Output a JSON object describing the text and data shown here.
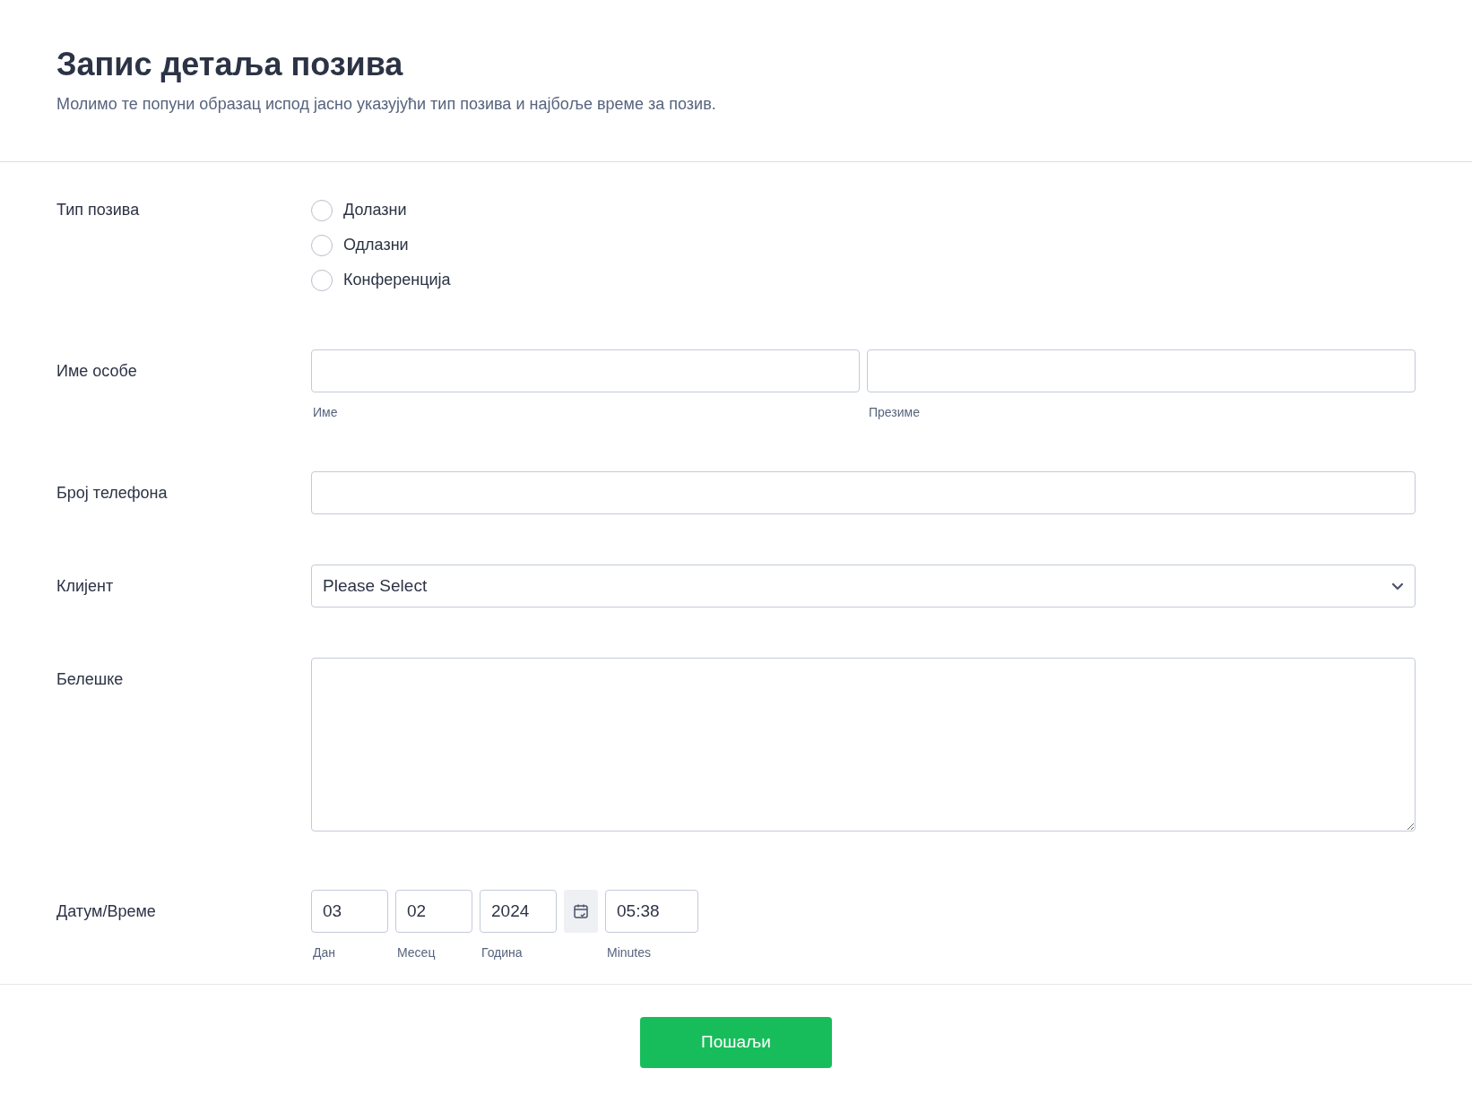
{
  "header": {
    "title": "Запис детаља позива",
    "subtitle": "Молимо те попуни образац испод јасно указујући тип позива и најбоље време за позив."
  },
  "fields": [
    {
      "kind": "radio",
      "label": "Тип позива",
      "options": [
        {
          "label": "Долазни",
          "selected": false
        },
        {
          "label": "Одлазни",
          "selected": false
        },
        {
          "label": "Конференција",
          "selected": false
        }
      ]
    },
    {
      "kind": "name",
      "label": "Име особе",
      "parts": [
        {
          "sublabel": "Име"
        },
        {
          "sublabel": "Презиме"
        }
      ]
    },
    {
      "kind": "text",
      "label": "Број телефона"
    },
    {
      "kind": "select",
      "label": "Клијент",
      "value": "Please Select"
    },
    {
      "kind": "textarea",
      "label": "Белешке"
    },
    {
      "kind": "datetime",
      "label": "Датум/Време",
      "parts": [
        {
          "kind": "input",
          "value": "03",
          "sublabel": "Дан"
        },
        {
          "kind": "input",
          "value": "02",
          "sublabel": "Месец"
        },
        {
          "kind": "input",
          "value": "2024",
          "sublabel": "Година"
        },
        {
          "kind": "calendar"
        },
        {
          "kind": "time",
          "value": "05:38",
          "sublabel": "Minutes"
        }
      ]
    }
  ],
  "submit": {
    "label": "Пошаљи"
  }
}
